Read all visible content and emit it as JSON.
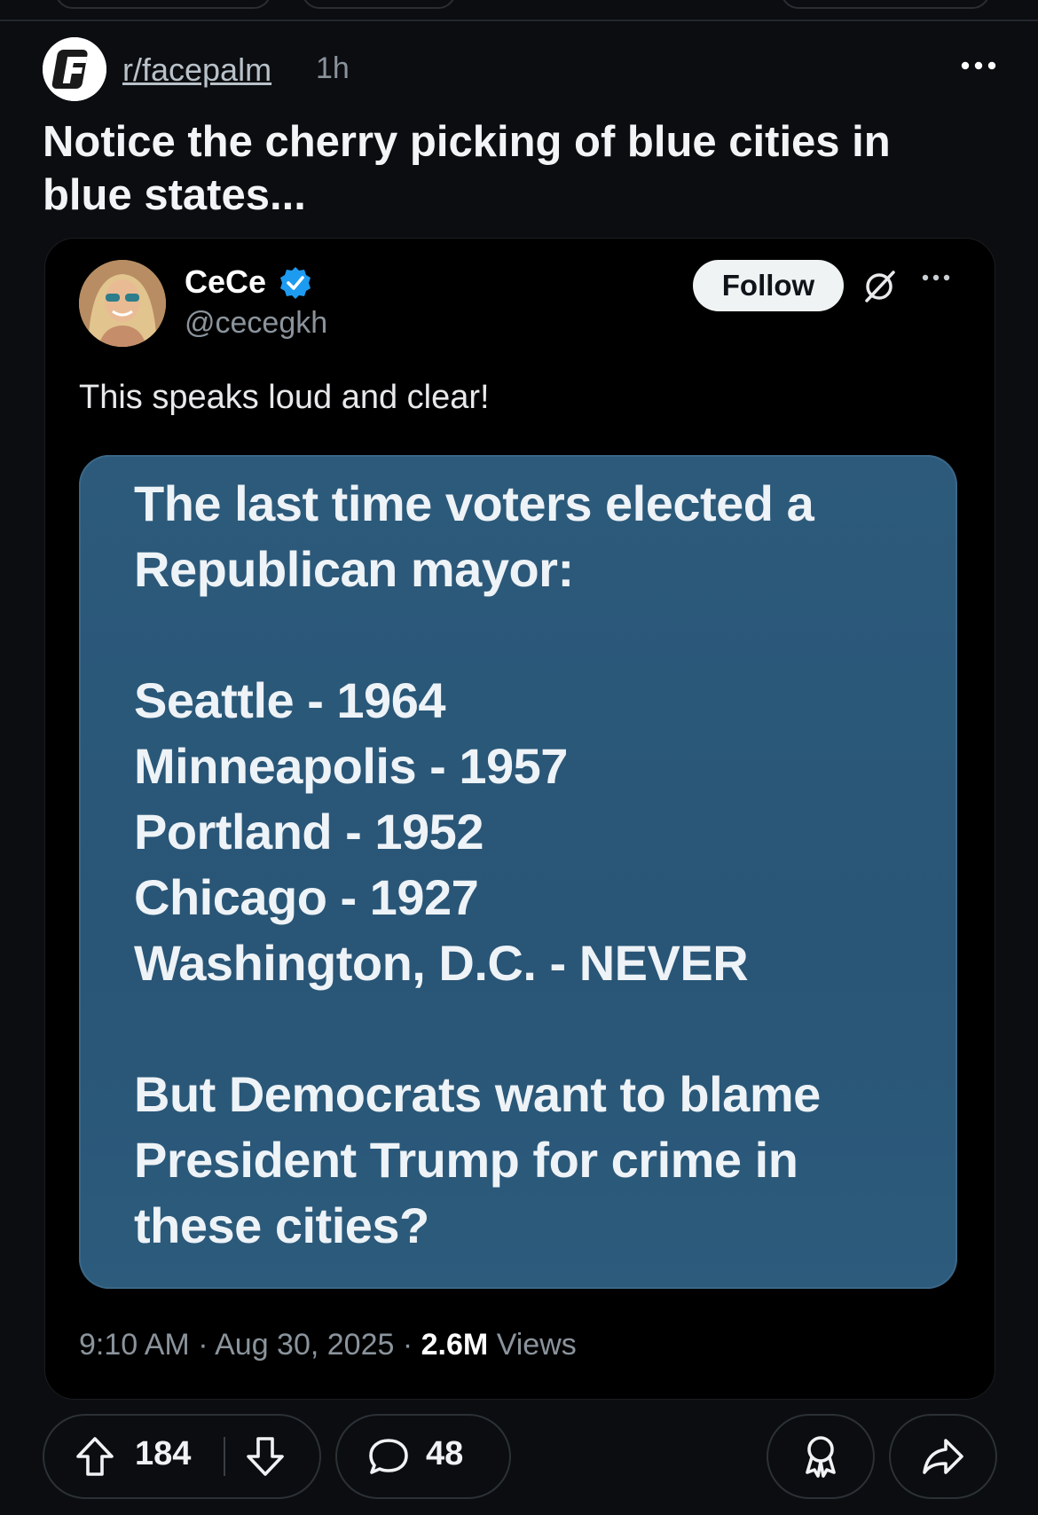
{
  "subreddit": {
    "name": "r/facepalm",
    "age": "1h"
  },
  "post": {
    "title": "Notice the cherry picking of blue cities in blue states..."
  },
  "tweet": {
    "display_name": "CeCe",
    "handle": "@cecegkh",
    "follow_label": "Follow",
    "text": "This speaks loud and clear!",
    "image_lines": {
      "intro1": "The last time voters elected a",
      "intro2": "Republican mayor:",
      "city1": "Seattle - 1964",
      "city2": "Minneapolis - 1957",
      "city3": "Portland - 1952",
      "city4": "Chicago - 1927",
      "city5": "Washington, D.C. - NEVER",
      "outro1": "But Democrats want to blame",
      "outro2": "President Trump for crime in",
      "outro3": "these cities?"
    },
    "time": "9:10 AM",
    "date": "Aug 30, 2025",
    "views_count": "2.6M",
    "views_label": "Views"
  },
  "actions": {
    "upvotes": "184",
    "comments": "48"
  },
  "icons": {
    "upvote": "arrow-up-icon",
    "downvote": "arrow-down-icon",
    "comment": "speech-bubble-icon",
    "award": "award-ribbon-icon",
    "share": "share-arrow-icon",
    "more": "ellipsis-icon",
    "verified": "verified-badge-icon",
    "grok": "grok-slash-icon"
  },
  "colors": {
    "background": "#0b0d10",
    "embed_background": "#000000",
    "meme_background": "#2b5878",
    "verified_blue": "#1d9bf0",
    "follow_button": "#eff3f4"
  }
}
